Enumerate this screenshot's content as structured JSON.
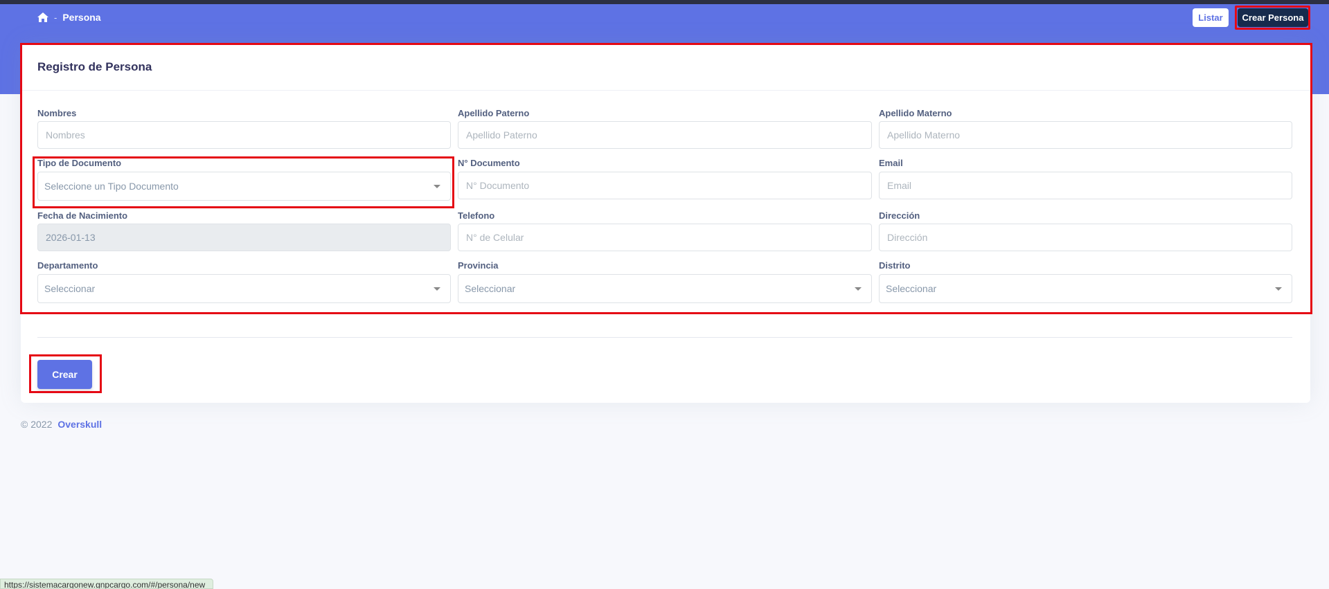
{
  "header": {
    "breadcrumb": {
      "separator": "-",
      "current": "Persona"
    },
    "buttons": {
      "listar": "Listar",
      "crear_persona": "Crear Persona"
    }
  },
  "card": {
    "title": "Registro de Persona"
  },
  "form": {
    "nombres": {
      "label": "Nombres",
      "placeholder": "Nombres"
    },
    "apellido_paterno": {
      "label": "Apellido Paterno",
      "placeholder": "Apellido Paterno"
    },
    "apellido_materno": {
      "label": "Apellido Materno",
      "placeholder": "Apellido Materno"
    },
    "tipo_documento": {
      "label": "Tipo de Documento",
      "placeholder": "Seleccione un Tipo Documento"
    },
    "n_documento": {
      "label": "N° Documento",
      "placeholder": "N° Documento"
    },
    "email": {
      "label": "Email",
      "placeholder": "Email"
    },
    "fecha_nacimiento": {
      "label": "Fecha de Nacimiento",
      "value": "2026-01-13"
    },
    "telefono": {
      "label": "Telefono",
      "placeholder": "N° de Celular"
    },
    "direccion": {
      "label": "Dirección",
      "placeholder": "Dirección"
    },
    "departamento": {
      "label": "Departamento",
      "placeholder": "Seleccionar"
    },
    "provincia": {
      "label": "Provincia",
      "placeholder": "Seleccionar"
    },
    "distrito": {
      "label": "Distrito",
      "placeholder": "Seleccionar"
    },
    "submit_label": "Crear"
  },
  "footer": {
    "copyright": "© 2022",
    "brand": "Overskull"
  },
  "status_bar": {
    "url": "https://sistemacargonew.gnpcargo.com/#/persona/new"
  },
  "colors": {
    "primary": "#5e72e4",
    "dark": "#172b4d",
    "highlight": "#e50914"
  }
}
